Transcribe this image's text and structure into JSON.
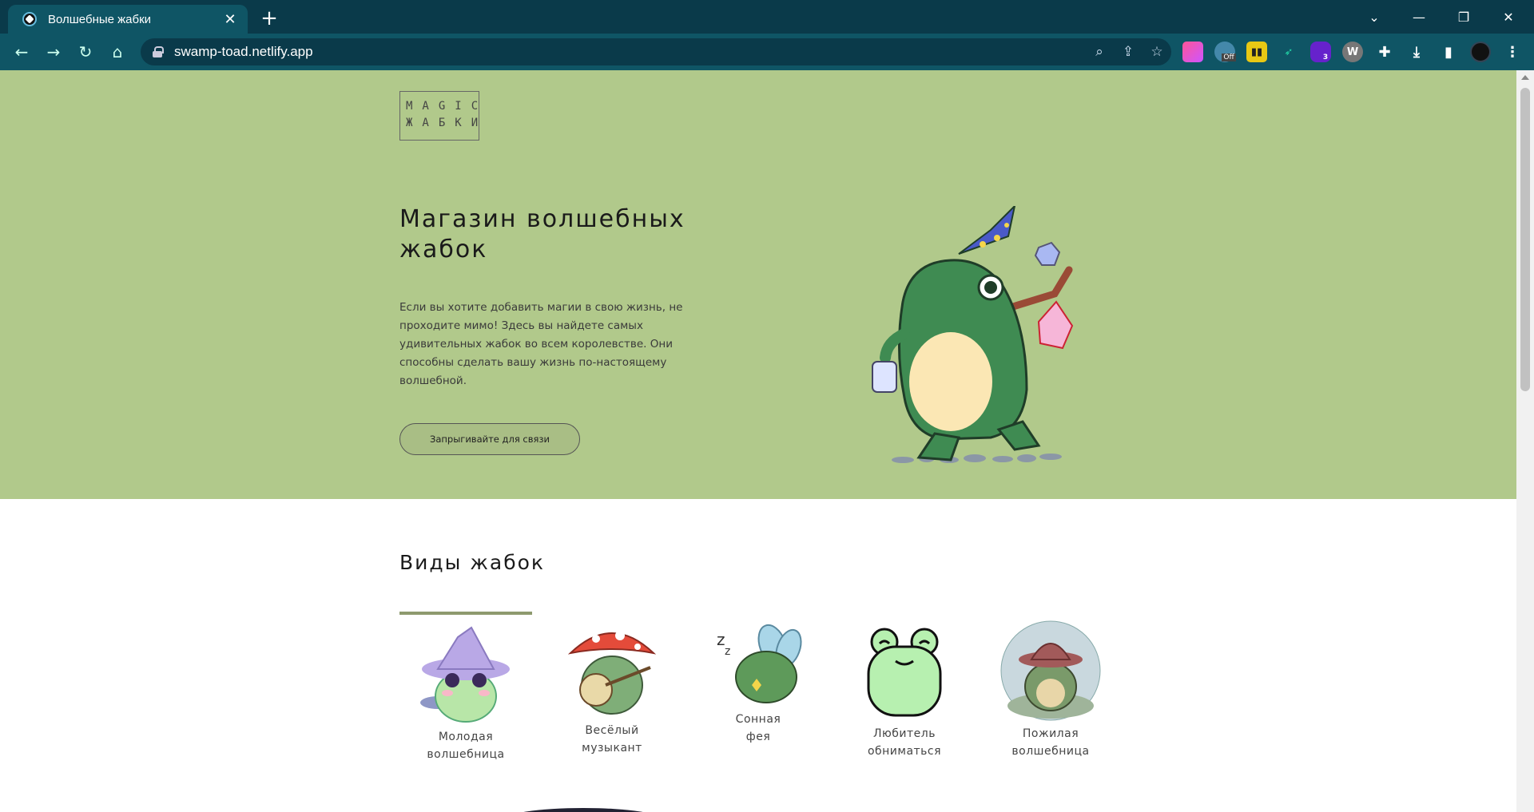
{
  "browser": {
    "tab_title": "Волшебные жабки",
    "url": "swamp-toad.netlify.app",
    "new_tab_icon": "plus-icon",
    "extension_badge_off": "Off",
    "extension_badge_count": "3"
  },
  "page": {
    "logo": {
      "line1": "MAGIC",
      "line2": "ЖАБКИ"
    },
    "hero": {
      "title": "Магазин волшебных жабок",
      "description": "Если вы хотите добавить магии в свою жизнь, не проходите мимо! Здесь вы найдете самых удивительных жабок во всем королевстве. Они способны сделать вашу жизнь по-настоящему волшебной.",
      "cta": "Запрыгивайте для связи"
    },
    "types": {
      "heading": "Виды жабок",
      "items": [
        {
          "line1": "Молодая",
          "line2": "волшебница"
        },
        {
          "line1": "Весёлый",
          "line2": "музыкант"
        },
        {
          "line1": "Сонная",
          "line2": "фея"
        },
        {
          "line1": "Любитель",
          "line2": "обниматься"
        },
        {
          "line1": "Пожилая",
          "line2": "волшебница"
        }
      ]
    }
  },
  "colors": {
    "hero_bg": "#b1c98b",
    "chrome_dark": "#0a3a4a",
    "chrome_toolbar": "#0f5565",
    "accent_underline": "#8e9a6e"
  }
}
